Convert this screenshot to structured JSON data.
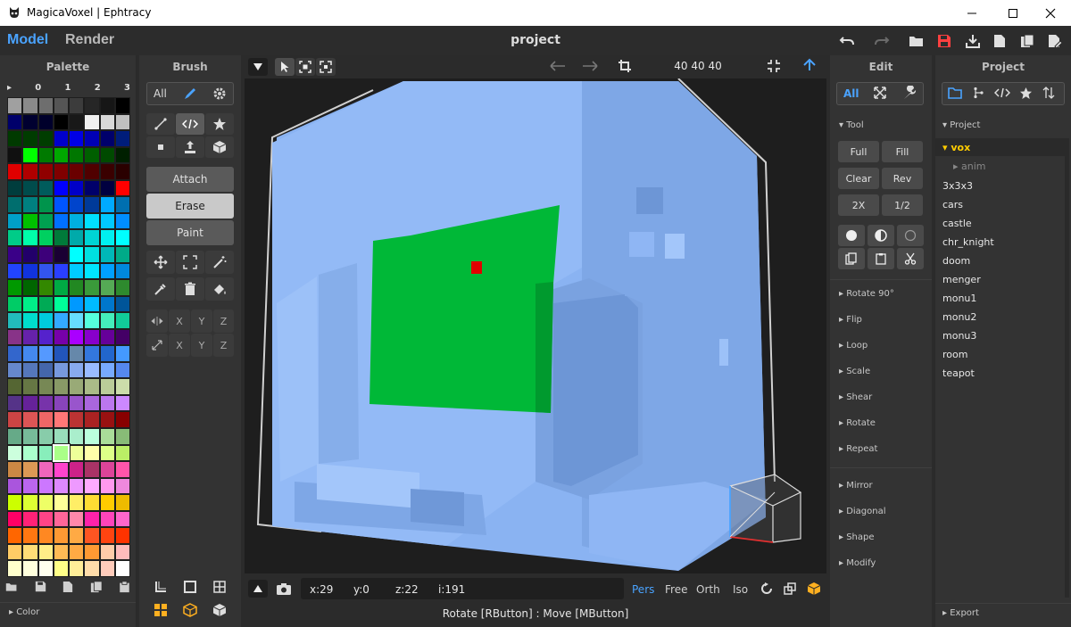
{
  "window": {
    "title": "MagicaVoxel | Ephtracy"
  },
  "top": {
    "model": "Model",
    "render": "Render",
    "project": "project"
  },
  "palette": {
    "title": "Palette",
    "cols": [
      "▸",
      "0",
      "1",
      "2",
      "3"
    ],
    "color_label": "Color",
    "rows": [
      [
        "#a0a0a0",
        "#8a8a8a",
        "#6e6e6e",
        "#555555",
        "#3c3c3c",
        "#262626",
        "#161616",
        "#000000"
      ],
      [
        "#00006a",
        "#000030",
        "#00002b",
        "#000000",
        "#181818",
        "#f0f0f0",
        "#d8d8d8",
        "#c0c0c0"
      ],
      [
        "#003a00",
        "#003c00",
        "#003d00",
        "#0000cc",
        "#0000e6",
        "#0000b5",
        "#00006b",
        "#001d7a"
      ],
      [
        "#101010",
        "#00ff00",
        "#007a00",
        "#00a800",
        "#007700",
        "#005f00",
        "#004a00",
        "#001f00"
      ],
      [
        "#e00000",
        "#b00000",
        "#900000",
        "#800000",
        "#6a0000",
        "#500000",
        "#3a0000",
        "#2a0000"
      ],
      [
        "#003d3d",
        "#004c4c",
        "#005c5c",
        "#0000ff",
        "#0000c8",
        "#00006a",
        "#000040",
        "#ff0000"
      ],
      [
        "#006e6e",
        "#008080",
        "#00944c",
        "#0055ff",
        "#0044cc",
        "#003a99",
        "#00aaff",
        "#006fb0"
      ],
      [
        "#00a0c8",
        "#00c000",
        "#00a050",
        "#0070ff",
        "#00b0e0",
        "#00e0ff",
        "#00c8ff",
        "#008eff"
      ],
      [
        "#00cc88",
        "#00ffaa",
        "#00d060",
        "#007a3a",
        "#00aaaa",
        "#00d4d4",
        "#00f0f0",
        "#00ffff"
      ],
      [
        "#3a0088",
        "#22006a",
        "#3d007a",
        "#1a0033",
        "#00ffff",
        "#00e0e0",
        "#00b8b8",
        "#00aa88"
      ],
      [
        "#2244ff",
        "#1133dd",
        "#3355ee",
        "#2a3fff",
        "#00ccff",
        "#00e6ff",
        "#00a0ff",
        "#0088dd"
      ],
      [
        "#009900",
        "#006600",
        "#338800",
        "#00aa44",
        "#228822",
        "#3a9a3a",
        "#55aa55",
        "#2e8a2e"
      ],
      [
        "#00cc66",
        "#00ee88",
        "#00aa55",
        "#00ff99",
        "#0099ff",
        "#00bbff",
        "#0077cc",
        "#005599"
      ],
      [
        "#22bbbb",
        "#00ddcc",
        "#00ccdd",
        "#33aaff",
        "#66ddff",
        "#55ffdd",
        "#44eebb",
        "#11cc99"
      ],
      [
        "#883388",
        "#6622aa",
        "#5522cc",
        "#7700aa",
        "#aa00ff",
        "#8800cc",
        "#660099",
        "#440066"
      ],
      [
        "#3366cc",
        "#4488ee",
        "#5599ff",
        "#2255bb",
        "#6688aa",
        "#3377dd",
        "#2266cc",
        "#4499ff"
      ],
      [
        "#6688cc",
        "#5577bb",
        "#4466aa",
        "#7799dd",
        "#88aaee",
        "#99bbff",
        "#77aaff",
        "#5588ee"
      ],
      [
        "#556633",
        "#667744",
        "#778855",
        "#889966",
        "#99aa77",
        "#aabb88",
        "#bbcc99",
        "#ccddaa"
      ],
      [
        "#553388",
        "#662299",
        "#7733aa",
        "#8844bb",
        "#9955cc",
        "#aa66dd",
        "#bb77ee",
        "#cc88ff"
      ],
      [
        "#cc4444",
        "#dd5555",
        "#ee6666",
        "#ff7777",
        "#bb3333",
        "#aa2222",
        "#991111",
        "#880000"
      ],
      [
        "#66aa88",
        "#77bb99",
        "#88ccaa",
        "#99ddbb",
        "#aaeecc",
        "#bbffdd",
        "#aadd99",
        "#88bb77"
      ],
      [
        "#ccffdd",
        "#aaffcc",
        "#88eebb",
        "#aaff88",
        "#eeff99",
        "#ffffaa",
        "#ddff88",
        "#bbee66"
      ],
      [
        "#cc8844",
        "#dd9955",
        "#ee66bb",
        "#ff44cc",
        "#cc2288",
        "#aa3366",
        "#dd4499",
        "#ff55aa"
      ],
      [
        "#aa55dd",
        "#bb66ee",
        "#cc77ff",
        "#dd88ff",
        "#ee99ff",
        "#ffaaff",
        "#ff99ee",
        "#ee88dd"
      ],
      [
        "#ccff00",
        "#ddff33",
        "#eeff66",
        "#ffff99",
        "#ffee66",
        "#ffdd33",
        "#ffcc00",
        "#eebb00"
      ],
      [
        "#ff0066",
        "#ff2277",
        "#ff4488",
        "#ff6699",
        "#ff88aa",
        "#ff22aa",
        "#ff44bb",
        "#ff66cc"
      ],
      [
        "#ff6600",
        "#ff7711",
        "#ff8822",
        "#ff9933",
        "#ffaa44",
        "#ff5522",
        "#ff4411",
        "#ff3300"
      ],
      [
        "#ffcc66",
        "#ffdd77",
        "#ffee88",
        "#ffbb55",
        "#ffaa44",
        "#ff9933",
        "#ffccaa",
        "#ffbbbb"
      ],
      [
        "#ffffcc",
        "#ffffdd",
        "#ffffee",
        "#ffff88",
        "#ffee99",
        "#ffddaa",
        "#ffccbb",
        "#ffffff"
      ]
    ],
    "selected_row": 21,
    "selected_col": 3
  },
  "brush": {
    "title": "Brush",
    "all": "All",
    "attach": "Attach",
    "erase": "Erase",
    "paint": "Paint",
    "x": "X",
    "y": "Y",
    "z": "Z"
  },
  "viewport": {
    "dims": "40  40  40",
    "coords": {
      "x": "x:29",
      "y": "y:0",
      "z": "z:22",
      "i": "i:191"
    },
    "views": {
      "pers": "Pers",
      "free": "Free",
      "orth": "Orth",
      "iso": "Iso"
    },
    "status": "Rotate [RButton] : Move [MButton]"
  },
  "edit": {
    "title": "Edit",
    "all": "All",
    "tool": "Tool",
    "buttons": [
      "Full",
      "Fill",
      "Clear",
      "Rev",
      "2X",
      "1/2"
    ],
    "sections": [
      "Rotate 90°",
      "Flip",
      "Loop",
      "Scale",
      "Shear",
      "Rotate",
      "Repeat",
      "Mirror",
      "Diagonal",
      "Shape",
      "Modify"
    ]
  },
  "project": {
    "title": "Project",
    "section": "Project",
    "folder": "vox",
    "subfolder": "anim",
    "items": [
      "3x3x3",
      "cars",
      "castle",
      "chr_knight",
      "doom",
      "menger",
      "monu1",
      "monu2",
      "monu3",
      "room",
      "teapot"
    ],
    "export": "Export"
  },
  "colors": {
    "accent": "#4aa3ff",
    "folder": "#ffcc00",
    "model_green": "#00b837",
    "voxel_blue": "#8fb8f5",
    "save_red": "#ff4040"
  }
}
